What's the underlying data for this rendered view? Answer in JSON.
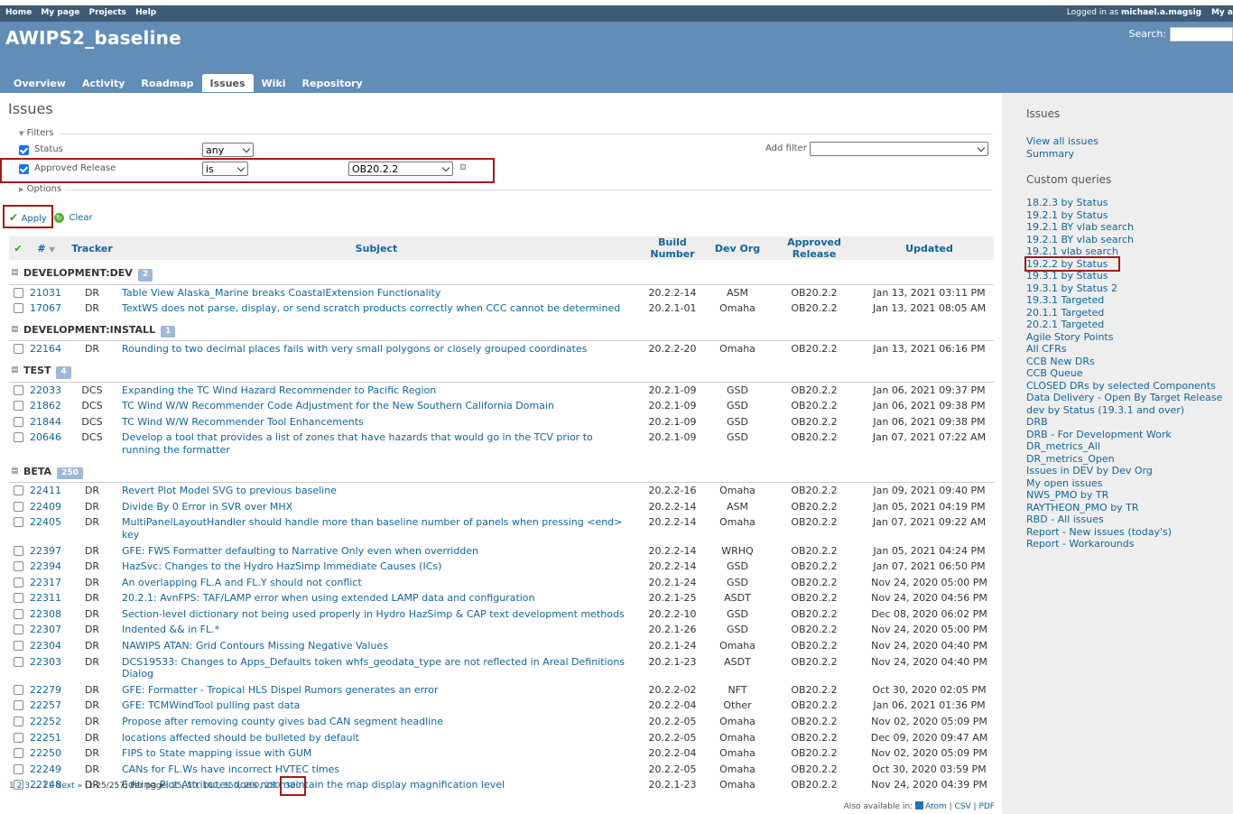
{
  "top_menu": {
    "links": [
      "Home",
      "My page",
      "Projects",
      "Help"
    ],
    "logged_in_prefix": "Logged in as",
    "username": "michael.a.magsig",
    "my_account": "My a"
  },
  "header": {
    "project_title": "AWIPS2_baseline",
    "search_label": "Search:"
  },
  "main_menu": {
    "tabs": [
      {
        "label": "Overview",
        "selected": false
      },
      {
        "label": "Activity",
        "selected": false
      },
      {
        "label": "Roadmap",
        "selected": false
      },
      {
        "label": "Issues",
        "selected": true
      },
      {
        "label": "Wiki",
        "selected": false
      },
      {
        "label": "Repository",
        "selected": false
      }
    ]
  },
  "page": {
    "title": "Issues",
    "filters_label": "Filters",
    "options_label": "Options",
    "add_filter_label": "Add filter",
    "apply_label": "Apply",
    "clear_label": "Clear",
    "filters": [
      {
        "label": "Status",
        "checked": true,
        "operator": "any",
        "value": ""
      },
      {
        "label": "Approved Release",
        "checked": true,
        "operator": "is",
        "value": "OB20.2.2"
      }
    ]
  },
  "table": {
    "columns": [
      "#",
      "Tracker",
      "Subject",
      "Build Number",
      "Dev Org",
      "Approved Release",
      "Updated"
    ],
    "groups": [
      {
        "name": "DEVELOPMENT:DEV",
        "count": "2",
        "rows": [
          {
            "id": "21031",
            "tracker": "DR",
            "subject": "Table View Alaska_Marine breaks CoastalExtension Functionality",
            "build": "20.2.2-14",
            "org": "ASM",
            "release": "OB20.2.2",
            "updated": "Jan 13, 2021 03:11 PM"
          },
          {
            "id": "17067",
            "tracker": "DR",
            "subject": "TextWS does not parse, display, or send scratch products correctly when CCC cannot be determined",
            "build": "20.2.1-01",
            "org": "Omaha",
            "release": "OB20.2.2",
            "updated": "Jan 13, 2021 08:05 AM"
          }
        ]
      },
      {
        "name": "DEVELOPMENT:INSTALL",
        "count": "1",
        "rows": [
          {
            "id": "22164",
            "tracker": "DR",
            "subject": "Rounding to two decimal places fails with very small polygons or closely grouped coordinates",
            "build": "20.2.2-20",
            "org": "Omaha",
            "release": "OB20.2.2",
            "updated": "Jan 13, 2021 06:16 PM"
          }
        ]
      },
      {
        "name": "TEST",
        "count": "4",
        "rows": [
          {
            "id": "22033",
            "tracker": "DCS",
            "subject": "Expanding the TC Wind Hazard Recommender to Pacific Region",
            "build": "20.2.1-09",
            "org": "GSD",
            "release": "OB20.2.2",
            "updated": "Jan 06, 2021 09:37 PM"
          },
          {
            "id": "21862",
            "tracker": "DCS",
            "subject": "TC Wind W/W Recommender Code Adjustment for the New Southern California Domain",
            "build": "20.2.1-09",
            "org": "GSD",
            "release": "OB20.2.2",
            "updated": "Jan 06, 2021 09:38 PM"
          },
          {
            "id": "21844",
            "tracker": "DCS",
            "subject": "TC Wind W/W Recommender Tool Enhancements",
            "build": "20.2.1-09",
            "org": "GSD",
            "release": "OB20.2.2",
            "updated": "Jan 06, 2021 09:38 PM"
          },
          {
            "id": "20646",
            "tracker": "DCS",
            "subject": "Develop a tool that provides a list of zones that have hazards that would go in the TCV prior to running the formatter",
            "build": "20.2.1-09",
            "org": "GSD",
            "release": "OB20.2.2",
            "updated": "Jan 07, 2021 07:22 AM"
          }
        ]
      },
      {
        "name": "BETA",
        "count": "250",
        "rows": [
          {
            "id": "22411",
            "tracker": "DR",
            "subject": "Revert Plot Model SVG to previous baseline",
            "build": "20.2.2-16",
            "org": "Omaha",
            "release": "OB20.2.2",
            "updated": "Jan 09, 2021 09:40 PM"
          },
          {
            "id": "22409",
            "tracker": "DR",
            "subject": "Divide By 0 Error in SVR over MHX",
            "build": "20.2.2-14",
            "org": "ASM",
            "release": "OB20.2.2",
            "updated": "Jan 05, 2021 04:19 PM"
          },
          {
            "id": "22405",
            "tracker": "DR",
            "subject": "MultiPanelLayoutHandler should handle more than baseline number of panels when pressing <end> key",
            "build": "20.2.2-14",
            "org": "Omaha",
            "release": "OB20.2.2",
            "updated": "Jan 07, 2021 09:22 AM"
          },
          {
            "id": "22397",
            "tracker": "DR",
            "subject": "GFE: FWS Formatter defaulting to Narrative Only even when overridden",
            "build": "20.2.2-14",
            "org": "WRHQ",
            "release": "OB20.2.2",
            "updated": "Jan 05, 2021 04:24 PM"
          },
          {
            "id": "22394",
            "tracker": "DR",
            "subject": "HazSvc: Changes to the Hydro HazSimp Immediate Causes (ICs)",
            "build": "20.2.2-14",
            "org": "GSD",
            "release": "OB20.2.2",
            "updated": "Jan 07, 2021 06:50 PM"
          },
          {
            "id": "22317",
            "tracker": "DR",
            "subject": "An overlapping FL.A and FL.Y should not conflict",
            "build": "20.2.1-24",
            "org": "GSD",
            "release": "OB20.2.2",
            "updated": "Nov 24, 2020 05:00 PM"
          },
          {
            "id": "22311",
            "tracker": "DR",
            "subject": "20.2.1: AvnFPS: TAF/LAMP error when using extended LAMP data and configuration",
            "build": "20.2.1-25",
            "org": "ASDT",
            "release": "OB20.2.2",
            "updated": "Nov 24, 2020 04:56 PM"
          },
          {
            "id": "22308",
            "tracker": "DR",
            "subject": "Section-level dictionary not being used properly in Hydro HazSimp & CAP text development methods",
            "build": "20.2.2-10",
            "org": "GSD",
            "release": "OB20.2.2",
            "updated": "Dec 08, 2020 06:02 PM"
          },
          {
            "id": "22307",
            "tracker": "DR",
            "subject": "Indented && in FL.*",
            "build": "20.2.1-26",
            "org": "GSD",
            "release": "OB20.2.2",
            "updated": "Nov 24, 2020 05:00 PM"
          },
          {
            "id": "22304",
            "tracker": "DR",
            "subject": "NAWIPS ATAN: Grid Contours Missing Negative Values",
            "build": "20.2.1-24",
            "org": "Omaha",
            "release": "OB20.2.2",
            "updated": "Nov 24, 2020 04:40 PM"
          },
          {
            "id": "22303",
            "tracker": "DR",
            "subject": "DCS19533: Changes to Apps_Defaults token whfs_geodata_type are not reflected in Areal Definitions Dialog",
            "build": "20.2.1-23",
            "org": "ASDT",
            "release": "OB20.2.2",
            "updated": "Nov 24, 2020 04:40 PM"
          },
          {
            "id": "22279",
            "tracker": "DR",
            "subject": "GFE: Formatter - Tropical HLS Dispel Rumors generates an error",
            "build": "20.2.2-02",
            "org": "NFT",
            "release": "OB20.2.2",
            "updated": "Oct 30, 2020 02:05 PM"
          },
          {
            "id": "22257",
            "tracker": "DR",
            "subject": "GFE: TCMWindTool pulling past data",
            "build": "20.2.2-04",
            "org": "Other",
            "release": "OB20.2.2",
            "updated": "Jan 06, 2021 01:36 PM"
          },
          {
            "id": "22252",
            "tracker": "DR",
            "subject": "Propose after removing county gives bad CAN segment headline",
            "build": "20.2.2-05",
            "org": "Omaha",
            "release": "OB20.2.2",
            "updated": "Nov 02, 2020 05:09 PM"
          },
          {
            "id": "22251",
            "tracker": "DR",
            "subject": "locations affected should be bulleted by default",
            "build": "20.2.2-05",
            "org": "Omaha",
            "release": "OB20.2.2",
            "updated": "Dec 09, 2020 09:47 AM"
          },
          {
            "id": "22250",
            "tracker": "DR",
            "subject": "FIPS to State mapping issue with GUM",
            "build": "20.2.2-04",
            "org": "Omaha",
            "release": "OB20.2.2",
            "updated": "Nov 02, 2020 05:09 PM"
          },
          {
            "id": "22249",
            "tracker": "DR",
            "subject": "CANs for FL.Ws have incorrect HVTEC times",
            "build": "20.2.2-05",
            "org": "Omaha",
            "release": "OB20.2.2",
            "updated": "Oct 30, 2020 03:59 PM"
          },
          {
            "id": "22248",
            "tracker": "DR",
            "subject": "Editing Plot Attributes does not maintain the map display magnification level",
            "build": "20.2.1-23",
            "org": "Omaha",
            "release": "OB20.2.2",
            "updated": "Nov 24, 2020 04:39 PM"
          }
        ]
      }
    ]
  },
  "pagination": {
    "pages": [
      "1",
      "2",
      "3"
    ],
    "ellipsis": "...",
    "last_page": "11",
    "next": "Next »",
    "range": "(1-25/257)",
    "per_page_label": "Per page:",
    "per_page_options": [
      "25",
      "50",
      "100",
      "150",
      "200",
      "250",
      "300"
    ]
  },
  "other_formats": {
    "label": "Also available in:",
    "formats": [
      "Atom",
      "CSV",
      "PDF"
    ]
  },
  "sidebar": {
    "issues_heading": "Issues",
    "issue_links": [
      "View all issues",
      "Summary"
    ],
    "custom_queries_heading": "Custom queries",
    "queries": [
      "18.2.3 by Status",
      "19.2.1 by Status",
      "19.2.1 BY vlab search",
      "19.2.1 BY vlab search",
      "19.2.1 vlab search",
      "19.2.2 by Status",
      "19.3.1 by Status",
      "19.3.1 by Status 2",
      "19.3.1 Targeted",
      "20.1.1 Targeted",
      "20.2.1 Targeted",
      "Agile Story Points",
      "All CFRs",
      "CCB New DRs",
      "CCB Queue",
      "CLOSED DRs by selected Components",
      "Data Delivery - Open By Target Release",
      "dev by Status (19.3.1 and over)",
      "DRB",
      "DRB - For Development Work",
      "DR_metrics_All",
      "DR_metrics_Open",
      "Issues in DEV by Dev Org",
      "My open issues",
      "NWS_PMO by TR",
      "RAYTHEON_PMO by TR",
      "RBD - All issues",
      "Report - New issues (today's)",
      "Report - Workarounds"
    ],
    "highlighted_query": "19.2.2 by Status"
  },
  "colors": {
    "header": "#628db6",
    "top_menu": "#3e5b76",
    "link": "#169",
    "highlight": "#a01c1c"
  }
}
